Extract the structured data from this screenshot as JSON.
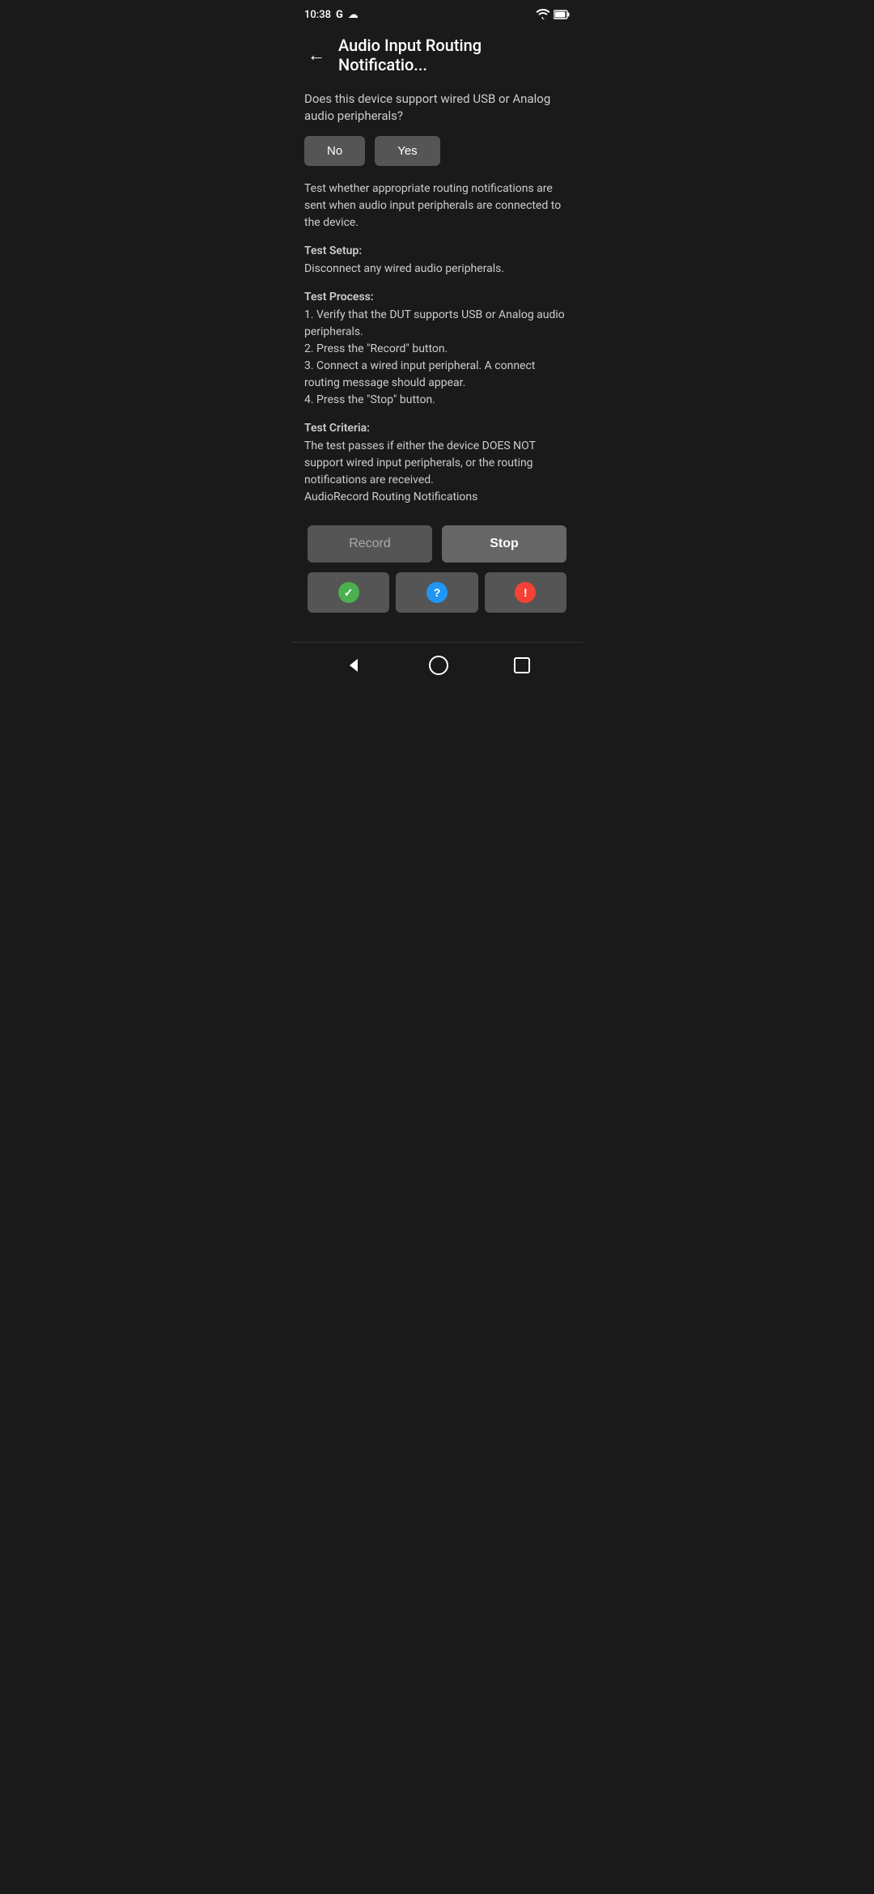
{
  "statusBar": {
    "time": "10:38",
    "googleIcon": "G",
    "cloudIcon": "☁"
  },
  "header": {
    "title": "Audio Input Routing Notificatio...",
    "backLabel": "←"
  },
  "content": {
    "questionText": "Does this device support wired USB or Analog audio peripherals?",
    "noLabel": "No",
    "yesLabel": "Yes",
    "descriptionText": "Test whether appropriate routing notifications are sent when audio input peripherals are connected to the device.",
    "testSetupLabel": "Test Setup:",
    "testSetupText": "Disconnect any wired audio peripherals.",
    "testProcessLabel": "Test Process:",
    "testProcessLines": [
      "1. Verify that the DUT supports USB or Analog audio peripherals.",
      "2. Press the \"Record\" button.",
      "3. Connect a wired input peripheral. A connect routing message should appear.",
      "4. Press the \"Stop\" button."
    ],
    "testCriteriaLabel": "Test Criteria:",
    "testCriteriaText": "The test passes if either the device DOES NOT support wired input peripherals, or the routing notifications are received.",
    "testCriteriaSubText": "AudioRecord Routing Notifications"
  },
  "actions": {
    "recordLabel": "Record",
    "stopLabel": "Stop"
  },
  "resultButtons": {
    "passIcon": "✓",
    "infoIcon": "?",
    "failIcon": "!"
  }
}
